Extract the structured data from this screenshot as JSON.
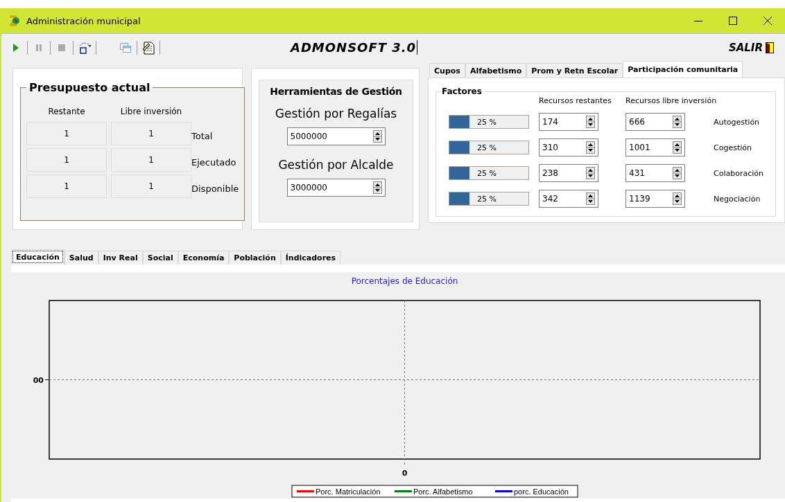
{
  "window": {
    "title": "Administración municipal"
  },
  "toolbar": {
    "app_title": "ADMONSOFT 3.0",
    "exit_label": "SALIR"
  },
  "budget": {
    "title": "Presupuesto actual",
    "columns": [
      "Restante",
      "Libre inversión"
    ],
    "rows": [
      {
        "label": "Total",
        "values": [
          "1",
          "1"
        ]
      },
      {
        "label": "Ejecutado",
        "values": [
          "1",
          "1"
        ]
      },
      {
        "label": "Disponible",
        "values": [
          "1",
          "1"
        ]
      }
    ]
  },
  "tools": {
    "title": "Herramientas de Gestión",
    "fields": [
      {
        "label": "Gestión por Regalías",
        "value": "5000000"
      },
      {
        "label": "Gestión por Alcalde",
        "value": "3000000"
      }
    ]
  },
  "top_tabs": [
    {
      "label": "Cupos",
      "selected": false
    },
    {
      "label": "Alfabetismo",
      "selected": false
    },
    {
      "label": "Prom y Retn Escolar",
      "selected": false
    },
    {
      "label": "Participación comunitaria",
      "selected": true
    }
  ],
  "factors": {
    "title": "Factores",
    "columns": [
      "Recursos restantes",
      "Recursos libre inversión"
    ],
    "rows": [
      {
        "level": 0.25,
        "reading": "25 %",
        "remaining": "174",
        "free": "666",
        "label": "Autogestión"
      },
      {
        "level": 0.25,
        "reading": "25 %",
        "remaining": "310",
        "free": "1001",
        "label": "Cogestión"
      },
      {
        "level": 0.25,
        "reading": "25 %",
        "remaining": "238",
        "free": "431",
        "label": "Colaboración"
      },
      {
        "level": 0.25,
        "reading": "25 %",
        "remaining": "342",
        "free": "1139",
        "label": "Negociación"
      }
    ]
  },
  "bottom_tabs": [
    {
      "label": "Educación",
      "selected": true
    },
    {
      "label": "Salud",
      "selected": false
    },
    {
      "label": "Inv Real",
      "selected": false
    },
    {
      "label": "Social",
      "selected": false
    },
    {
      "label": "Economía",
      "selected": false
    },
    {
      "label": "Población",
      "selected": false
    },
    {
      "label": "Índicadores",
      "selected": false
    }
  ],
  "chart": {
    "title": "Porcentajes de Educación",
    "y_tick_label": "00",
    "x_tick_label": "0",
    "legend": [
      {
        "name": "Porc. Matriculación",
        "color": "#ff0000"
      },
      {
        "name": "Porc. Alfabetismo",
        "color": "#008000"
      },
      {
        "name": "porc. Educación",
        "color": "#0000ff"
      }
    ]
  }
}
